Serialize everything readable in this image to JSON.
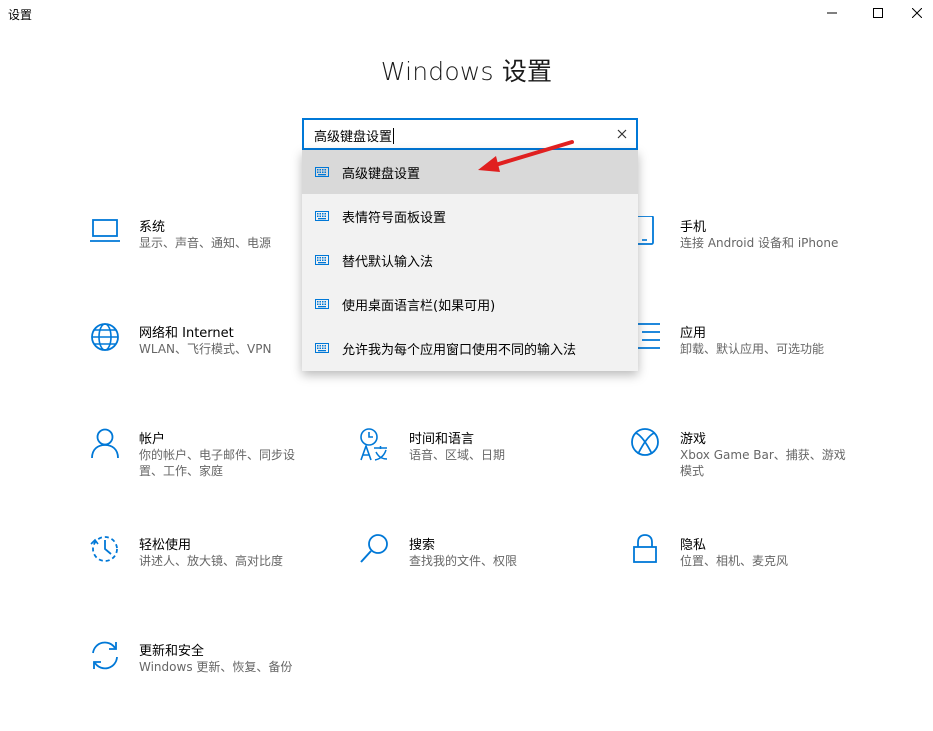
{
  "window": {
    "title": "设置",
    "minimize_icon": "minimize-icon",
    "maximize_icon": "maximize-icon",
    "close_icon": "close-icon"
  },
  "header": {
    "title": "Windows 设置"
  },
  "search": {
    "value": "高级键盘设置",
    "clear_icon": "clear-icon",
    "suggestions": [
      {
        "label": "高级键盘设置",
        "icon": "keyboard-icon",
        "selected": true
      },
      {
        "label": "表情符号面板设置",
        "icon": "keyboard-icon"
      },
      {
        "label": "替代默认输入法",
        "icon": "keyboard-icon"
      },
      {
        "label": "使用桌面语言栏(如果可用)",
        "icon": "keyboard-icon"
      },
      {
        "label": "允许我为每个应用窗口使用不同的输入法",
        "icon": "keyboard-icon"
      }
    ]
  },
  "annotation": {
    "color": "#e02020"
  },
  "accent": "#0078d7",
  "tiles": [
    {
      "title": "系统",
      "subtitle": "显示、声音、通知、电源",
      "icon": "laptop-icon"
    },
    {
      "title": "手机",
      "subtitle": "连接 Android 设备和 iPhone",
      "icon": "phone-icon"
    },
    {
      "title": "网络和 Internet",
      "subtitle": "WLAN、飞行模式、VPN",
      "icon": "globe-icon"
    },
    {
      "title": "应用",
      "subtitle": "卸载、默认应用、可选功能",
      "icon": "apps-list-icon"
    },
    {
      "title": "帐户",
      "subtitle": "你的帐户、电子邮件、同步设置、工作、家庭",
      "icon": "person-icon"
    },
    {
      "title": "时间和语言",
      "subtitle": "语音、区域、日期",
      "icon": "time-language-icon"
    },
    {
      "title": "游戏",
      "subtitle": "Xbox Game Bar、捕获、游戏模式",
      "icon": "xbox-icon"
    },
    {
      "title": "轻松使用",
      "subtitle": "讲述人、放大镜、高对比度",
      "icon": "ease-of-access-icon"
    },
    {
      "title": "搜索",
      "subtitle": "查找我的文件、权限",
      "icon": "search-icon"
    },
    {
      "title": "隐私",
      "subtitle": "位置、相机、麦克风",
      "icon": "lock-icon"
    },
    {
      "title": "更新和安全",
      "subtitle": "Windows 更新、恢复、备份",
      "icon": "update-icon"
    }
  ]
}
